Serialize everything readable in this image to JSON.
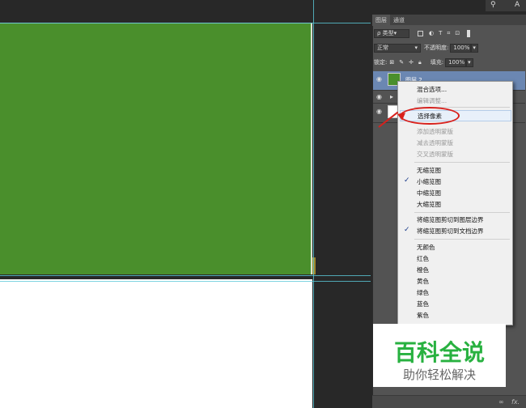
{
  "topbar": {
    "label": "A"
  },
  "panel": {
    "tabs": [
      "图层",
      "通道"
    ],
    "filter_label": "ρ 类型",
    "blend_mode": "正常",
    "opacity_label": "不透明度:",
    "opacity_value": "100%",
    "lock_label": "锁定:",
    "fill_label": "填充:",
    "fill_value": "100%",
    "layer_name": "图层 2"
  },
  "menu": {
    "items": [
      {
        "label": "混合选项..."
      },
      {
        "label": "编辑调整..."
      },
      {
        "label": "选择像素"
      },
      {
        "label": "添加透明蒙版"
      },
      {
        "label": "减去透明蒙版"
      },
      {
        "label": "交叉透明蒙版"
      },
      {
        "label": "无缩览图"
      },
      {
        "label": "小缩览图"
      },
      {
        "label": "中缩览图"
      },
      {
        "label": "大缩览图"
      },
      {
        "label": "将缩览图剪切到图层边界"
      },
      {
        "label": "将缩览图剪切到文档边界"
      },
      {
        "label": "无颜色"
      },
      {
        "label": "红色"
      },
      {
        "label": "橙色"
      },
      {
        "label": "黄色"
      },
      {
        "label": "绿色"
      },
      {
        "label": "蓝色"
      },
      {
        "label": "紫色"
      }
    ],
    "check": "✓"
  },
  "watermark": {
    "title": "百科全说",
    "subtitle": "助你轻松解决"
  },
  "bottom": {
    "link": "∞",
    "fx": "fx."
  },
  "colors": {
    "canvas_green": "#4a8f2c",
    "highlight_red": "#d8201c"
  }
}
